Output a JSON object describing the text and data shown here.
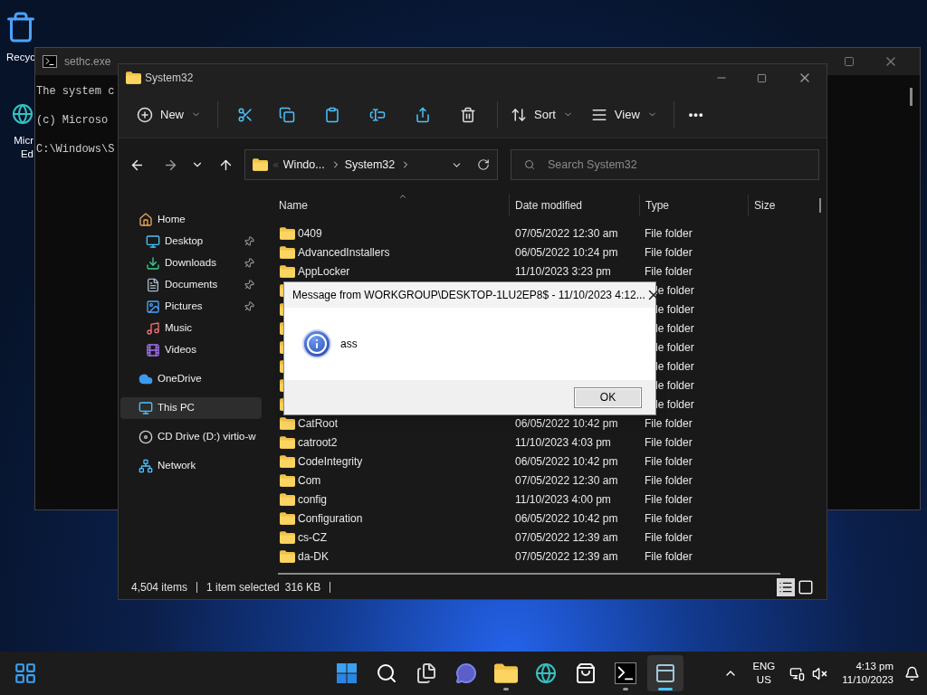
{
  "desktop_icons": [
    {
      "kind": "recycle",
      "lines": [
        "Recyc"
      ]
    },
    {
      "kind": "edge",
      "lines": [
        "Micr",
        "Ed"
      ]
    }
  ],
  "console": {
    "title": "sethc.exe",
    "lines": [
      "The system c",
      "(c) Microso",
      "C:\\Windows\\S"
    ]
  },
  "explorer": {
    "title": "System32",
    "toolbar": {
      "new": "New",
      "sort": "Sort",
      "view": "View",
      "more": "•••"
    },
    "address": {
      "crumbs": [
        "Windo...",
        "System32"
      ]
    },
    "search": {
      "placeholder": "Search System32"
    },
    "nav": [
      {
        "label": "Home",
        "kind": "home",
        "selected": false,
        "pinned": false,
        "children": [
          {
            "label": "Desktop",
            "kind": "desktop",
            "selected": false,
            "pinned": true
          },
          {
            "label": "Downloads",
            "kind": "downloads",
            "selected": false,
            "pinned": true
          },
          {
            "label": "Documents",
            "kind": "documents",
            "selected": false,
            "pinned": true
          },
          {
            "label": "Pictures",
            "kind": "pictures",
            "selected": false,
            "pinned": true
          },
          {
            "label": "Music",
            "kind": "music",
            "selected": false,
            "pinned": false
          },
          {
            "label": "Videos",
            "kind": "videos",
            "selected": false,
            "pinned": false
          }
        ]
      },
      {
        "label": "OneDrive",
        "kind": "cloud",
        "selected": false,
        "pinned": false
      },
      {
        "label": "This PC",
        "kind": "pc",
        "selected": true,
        "pinned": false
      },
      {
        "label": "CD Drive (D:) virtio-w",
        "kind": "drive",
        "selected": false,
        "pinned": false
      },
      {
        "label": "Network",
        "kind": "network",
        "selected": false,
        "pinned": false
      }
    ],
    "columns": [
      "Name",
      "Date modified",
      "Type",
      "Size"
    ],
    "rows": [
      {
        "name": "0409",
        "date": "07/05/2022 12:30 am",
        "type": "File folder"
      },
      {
        "name": "AdvancedInstallers",
        "date": "06/05/2022 10:24 pm",
        "type": "File folder"
      },
      {
        "name": "AppLocker",
        "date": "11/10/2023 3:23 pm",
        "type": "File folder"
      },
      {
        "type": "le folder"
      },
      {
        "type": "le folder"
      },
      {
        "type": "le folder"
      },
      {
        "type": "le folder"
      },
      {
        "type": "le folder"
      },
      {
        "type": "le folder"
      },
      {
        "type": "le folder"
      },
      {
        "name": "CatRoot",
        "date": "06/05/2022 10:42 pm",
        "type": "File folder"
      },
      {
        "name": "catroot2",
        "date": "11/10/2023 4:03 pm",
        "type": "File folder"
      },
      {
        "name": "CodeIntegrity",
        "date": "06/05/2022 10:42 pm",
        "type": "File folder"
      },
      {
        "name": "Com",
        "date": "07/05/2022 12:30 am",
        "type": "File folder"
      },
      {
        "name": "config",
        "date": "11/10/2023 4:00 pm",
        "type": "File folder"
      },
      {
        "name": "Configuration",
        "date": "06/05/2022 10:42 pm",
        "type": "File folder"
      },
      {
        "name": "cs-CZ",
        "date": "07/05/2022 12:39 am",
        "type": "File folder"
      },
      {
        "name": "da-DK",
        "date": "07/05/2022 12:39 am",
        "type": "File folder"
      }
    ],
    "status": {
      "items": "4,504 items",
      "selected": "1 item selected",
      "size": "316 KB"
    }
  },
  "dialog": {
    "title": "Message from WORKGROUP\\DESKTOP-1LU2EP8$ - 11/10/2023 4:12...",
    "message": "ass",
    "button": "OK"
  },
  "taskbar": {
    "apps": [
      {
        "kind": "start",
        "running": false,
        "active": false
      },
      {
        "kind": "search",
        "running": false,
        "active": false
      },
      {
        "kind": "taskview",
        "running": false,
        "active": false
      },
      {
        "kind": "chat",
        "running": false,
        "active": false
      },
      {
        "kind": "explorer",
        "running": true,
        "active": false
      },
      {
        "kind": "edge",
        "running": false,
        "active": false
      },
      {
        "kind": "store",
        "running": false,
        "active": false
      },
      {
        "kind": "terminal",
        "running": true,
        "active": false
      },
      {
        "kind": "app",
        "running": true,
        "active": true
      }
    ],
    "lang": [
      "ENG",
      "US"
    ],
    "time": "4:13 pm",
    "date": "11/10/2023"
  }
}
